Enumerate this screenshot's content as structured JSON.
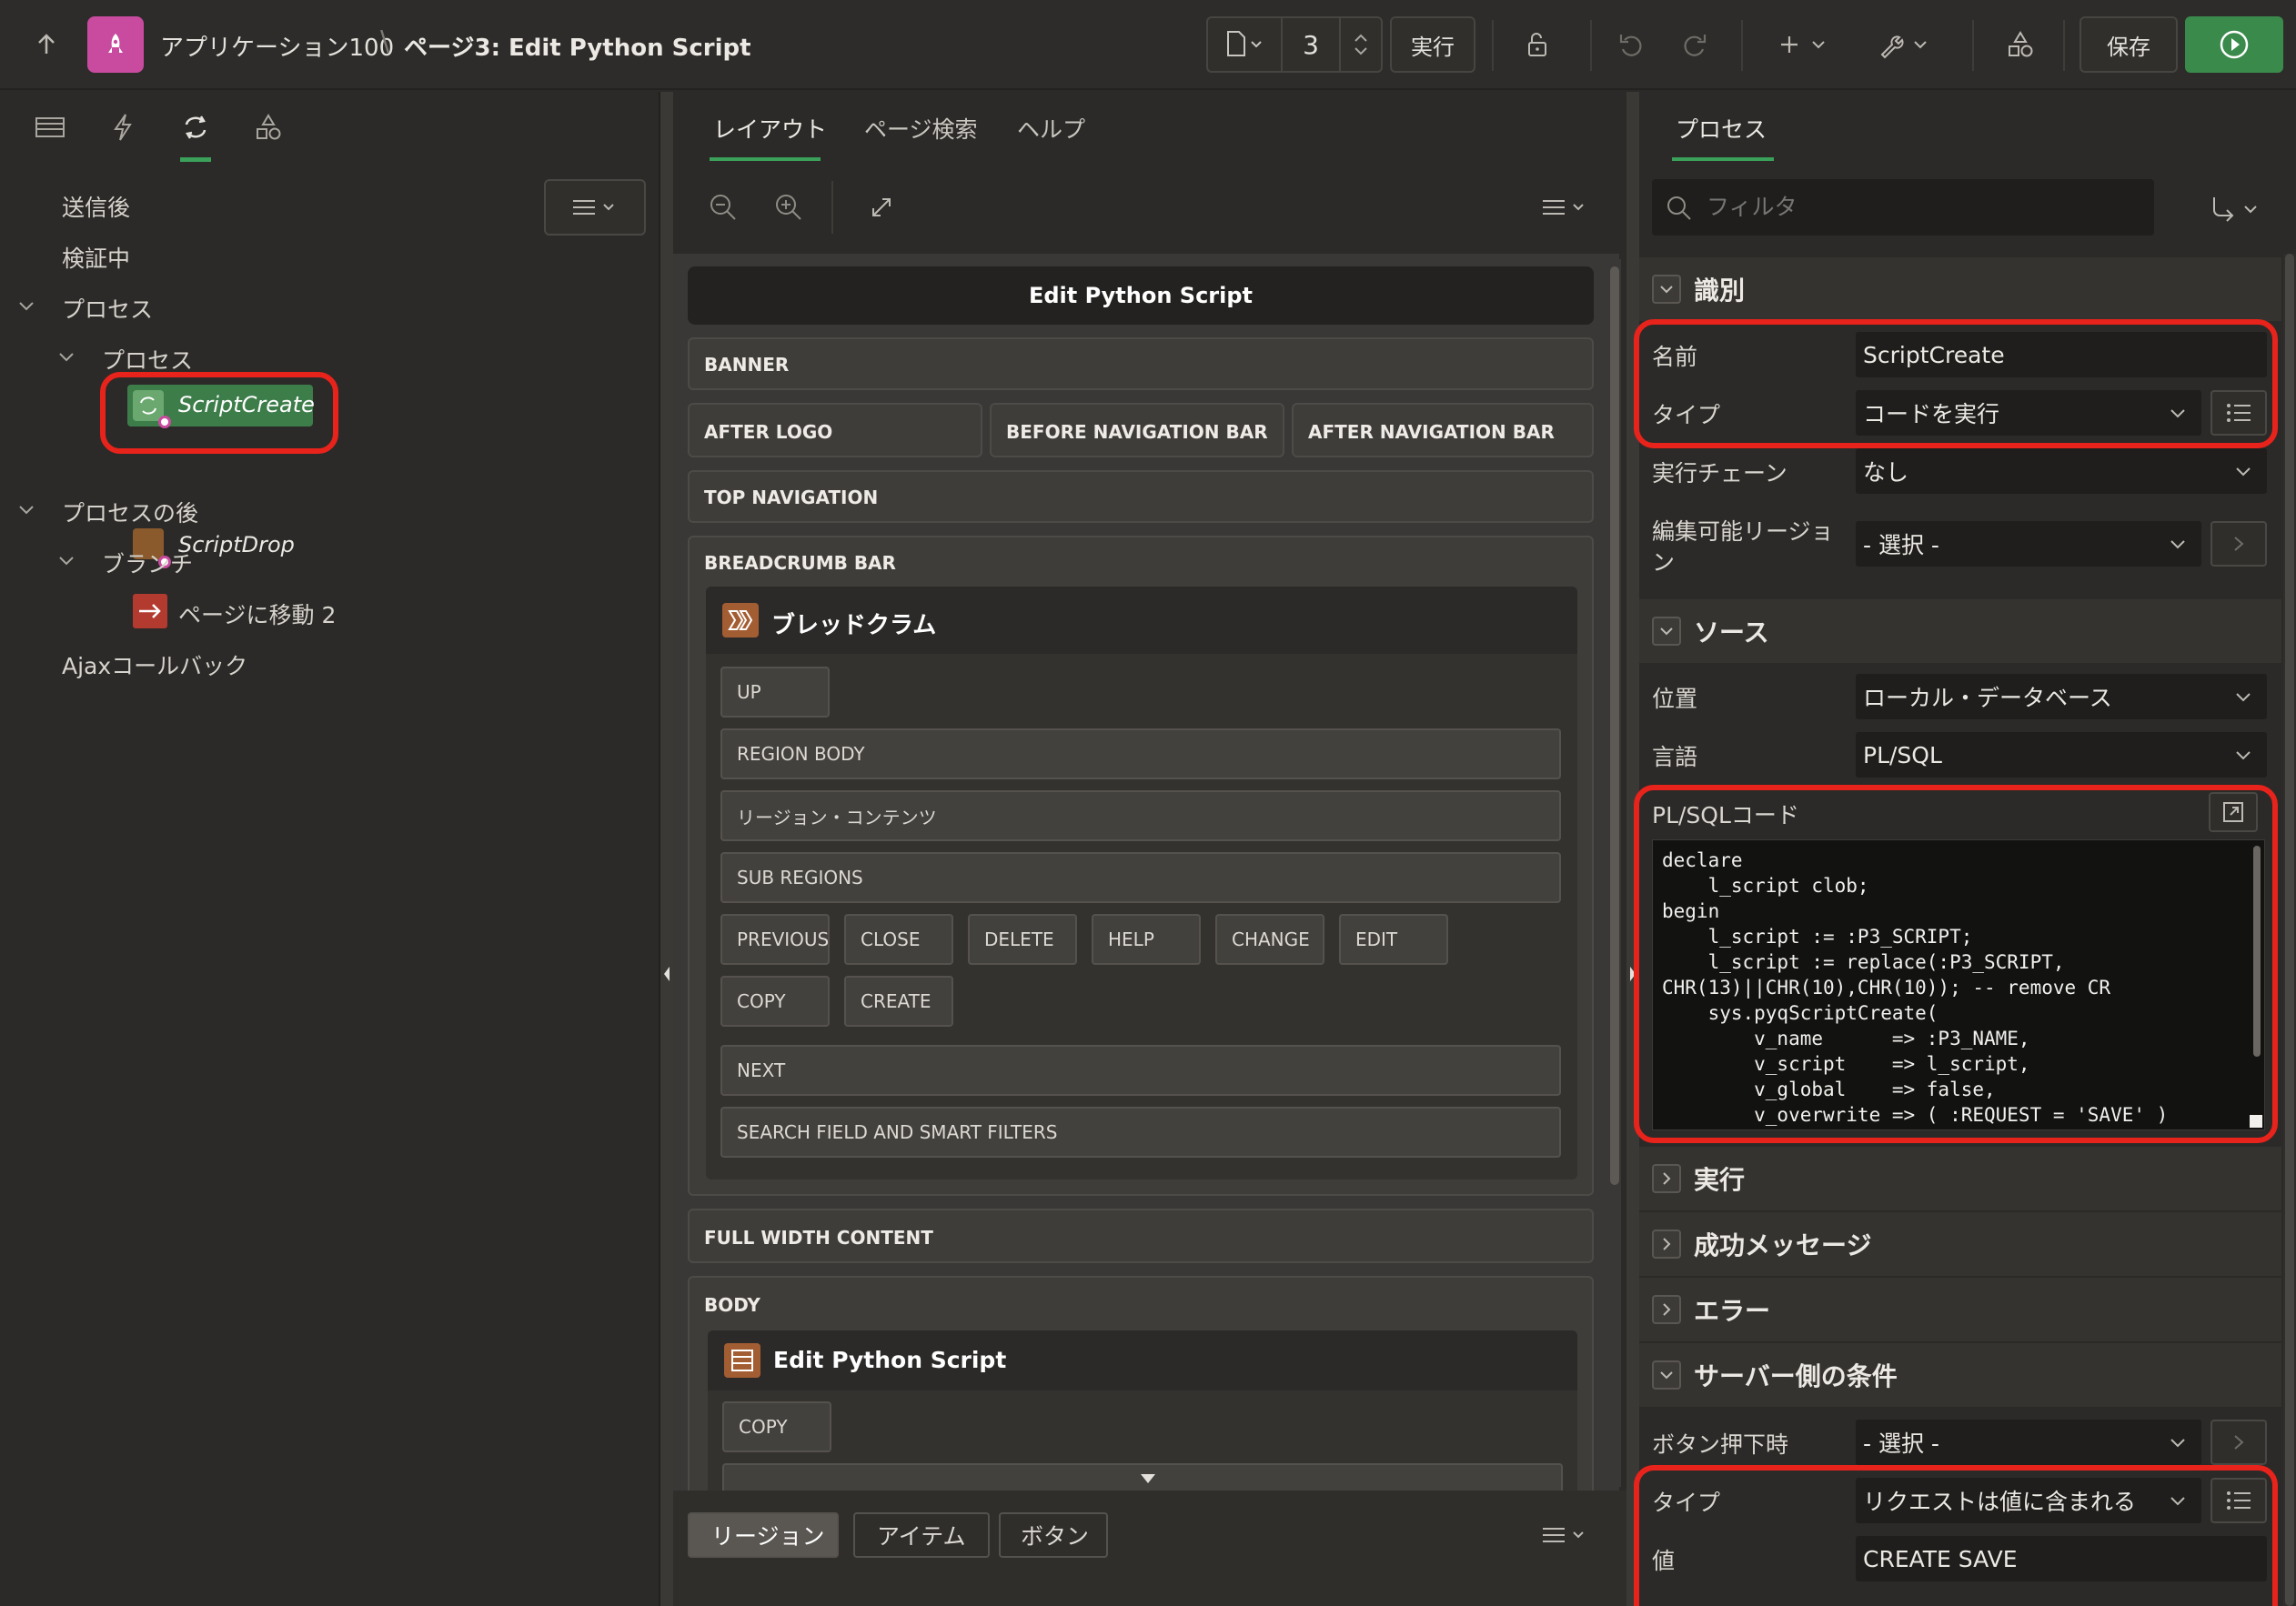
{
  "header": {
    "app_name": "アプリケーション100",
    "separator": "\\",
    "page_name": "ページ3: Edit Python Script",
    "page_number": "3",
    "run_label": "実行",
    "save_label": "保存"
  },
  "left_panel": {
    "tree": {
      "after_submit": "送信後",
      "validating": "検証中",
      "processes_group": "プロセス",
      "processes_sub": "プロセス",
      "script_create": "ScriptCreate",
      "script_drop": "ScriptDrop",
      "after_processing": "プロセスの後",
      "branch": "ブランチ",
      "go_to_page": "ページに移動 2",
      "ajax_callback": "Ajaxコールバック"
    }
  },
  "middle_panel": {
    "tabs": [
      "レイアウト",
      "ページ検索",
      "ヘルプ"
    ],
    "page_title": "Edit Python Script",
    "slots": {
      "banner": "BANNER",
      "after_logo": "AFTER LOGO",
      "before_nav": "BEFORE NAVIGATION BAR",
      "after_nav": "AFTER NAVIGATION BAR",
      "top_nav": "TOP NAVIGATION",
      "breadcrumb_bar": "BREADCRUMB BAR",
      "breadcrumb_region": "ブレッドクラム",
      "up": "UP",
      "region_body": "REGION BODY",
      "region_contents": "リージョン・コンテンツ",
      "sub_regions": "SUB REGIONS",
      "previous": "PREVIOUS",
      "close": "CLOSE",
      "delete": "DELETE",
      "help": "HELP",
      "change": "CHANGE",
      "edit": "EDIT",
      "copy": "COPY",
      "create": "CREATE",
      "next": "NEXT",
      "search_field": "SEARCH FIELD AND SMART FILTERS",
      "full_width": "FULL WIDTH CONTENT",
      "body": "BODY",
      "body_region": "Edit Python Script",
      "body_copy": "COPY"
    },
    "bottom_tabs": [
      "リージョン",
      "アイテム",
      "ボタン"
    ]
  },
  "right_panel": {
    "tab": "プロセス",
    "filter_placeholder": "フィルタ",
    "identification": {
      "title": "識別",
      "name_label": "名前",
      "name_value": "ScriptCreate",
      "type_label": "タイプ",
      "type_value": "コードを実行",
      "chain_label": "実行チェーン",
      "chain_value": "なし",
      "editable_label_1": "編集可能リージョ",
      "editable_label_2": "ン",
      "editable_value": "- 選択 -"
    },
    "source": {
      "title": "ソース",
      "location_label": "位置",
      "location_value": "ローカル・データベース",
      "language_label": "言語",
      "language_value": "PL/SQL",
      "code_label": "PL/SQLコード",
      "code_lines": [
        "declare",
        "    l_script clob;",
        "begin",
        "    l_script := :P3_SCRIPT;",
        "    l_script := replace(:P3_SCRIPT,",
        "CHR(13)||CHR(10),CHR(10)); -- remove CR",
        "    sys.pyqScriptCreate(",
        "        v_name      => :P3_NAME,",
        "        v_script    => l_script,",
        "        v_global    => false,",
        "        v_overwrite => ( :REQUEST = 'SAVE' )"
      ]
    },
    "sections": {
      "execution": "実行",
      "success_message": "成功メッセージ",
      "error": "エラー",
      "server_condition": "サーバー側の条件"
    },
    "server_condition": {
      "button_label": "ボタン押下時",
      "button_value": "- 選択 -",
      "type_label": "タイプ",
      "type_value": "リクエストは値に含まれる",
      "value_label": "値",
      "value_value": "CREATE SAVE"
    }
  }
}
